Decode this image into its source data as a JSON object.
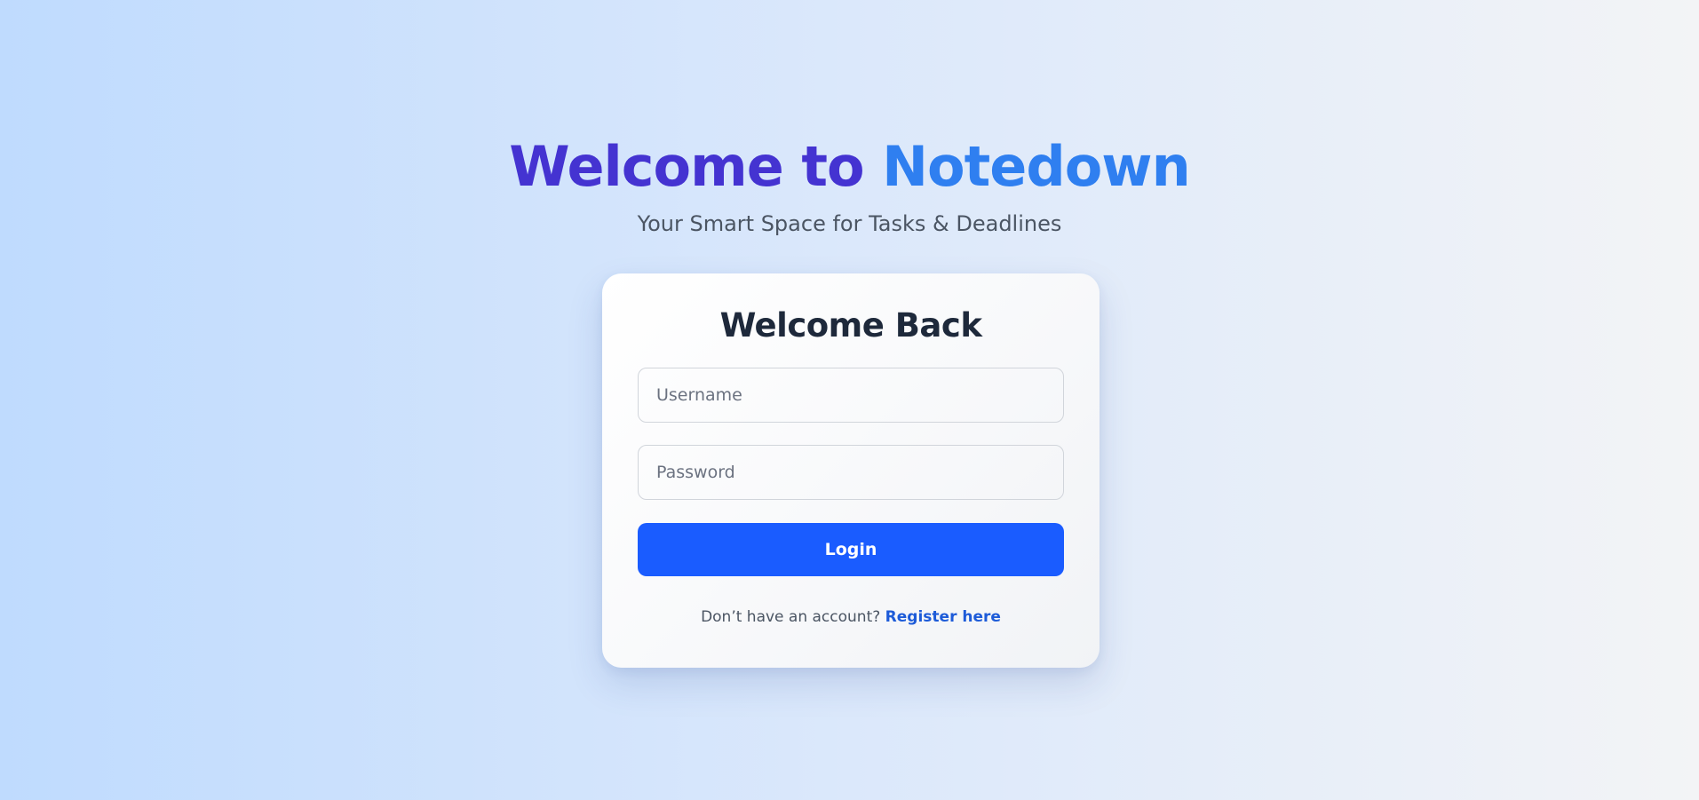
{
  "hero": {
    "title_part1": "Welcome to",
    "title_part2": "Notedown",
    "subtitle": "Your Smart Space for Tasks & Deadlines"
  },
  "login_card": {
    "title": "Welcome Back",
    "username_placeholder": "Username",
    "username_value": "",
    "password_placeholder": "Password",
    "password_value": "",
    "login_label": "Login",
    "no_account_text": "Don’t have an account?",
    "register_label": "Register here"
  },
  "colors": {
    "title_primary": "#4433d1",
    "title_accent": "#2f7ff0",
    "button_bg": "#1a5cff",
    "link": "#1d5bd8"
  }
}
